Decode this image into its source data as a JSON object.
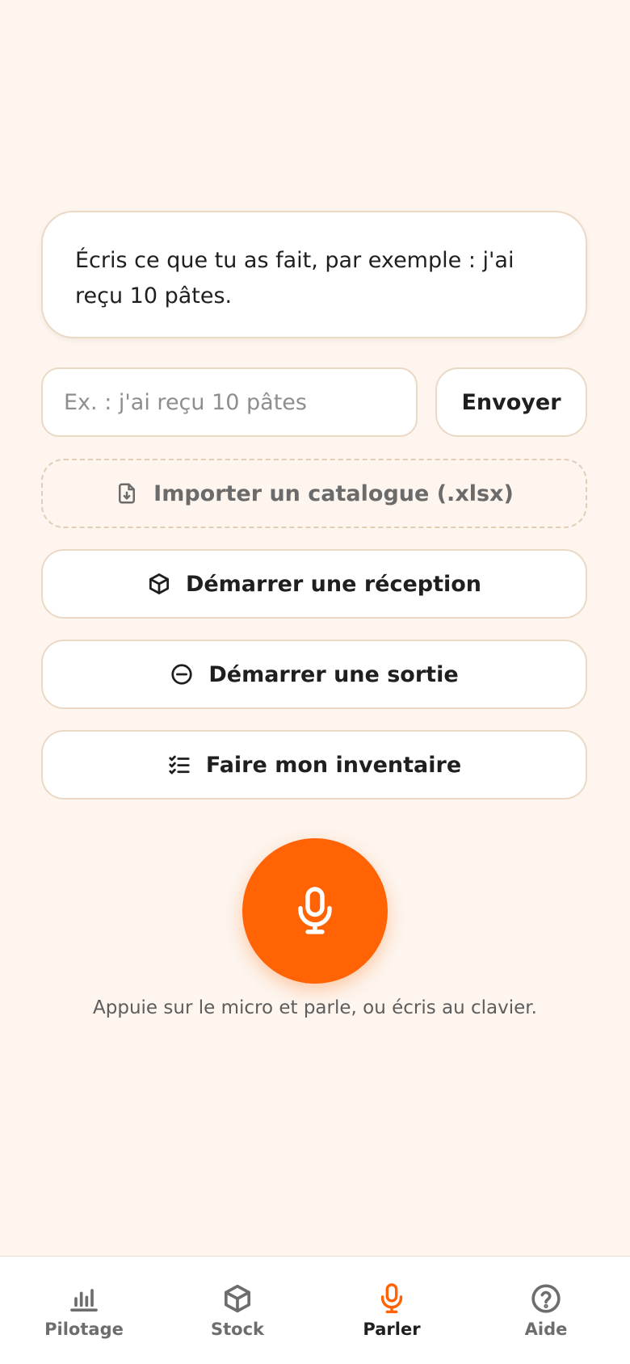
{
  "prompt_card": {
    "text": "Écris ce que tu as fait, par exemple : j'ai reçu 10 pâtes."
  },
  "composer": {
    "placeholder": "Ex. : j'ai reçu 10 pâtes",
    "value": "",
    "send_label": "Envoyer"
  },
  "actions": {
    "import_label": "Importer un catalogue (.xlsx)",
    "reception_label": "Démarrer une réception",
    "sortie_label": "Démarrer une sortie",
    "inventaire_label": "Faire mon inventaire"
  },
  "mic": {
    "hint": "Appuie sur le micro et parle, ou écris au clavier."
  },
  "nav": {
    "items": [
      {
        "label": "Pilotage",
        "icon": "bar-chart-icon"
      },
      {
        "label": "Stock",
        "icon": "box-icon"
      },
      {
        "label": "Parler",
        "icon": "microphone-icon",
        "active": true
      },
      {
        "label": "Aide",
        "icon": "help-circle-icon"
      }
    ]
  },
  "colors": {
    "accent": "#ff6304",
    "background": "#fdf5ee",
    "border": "#ead9c4"
  }
}
